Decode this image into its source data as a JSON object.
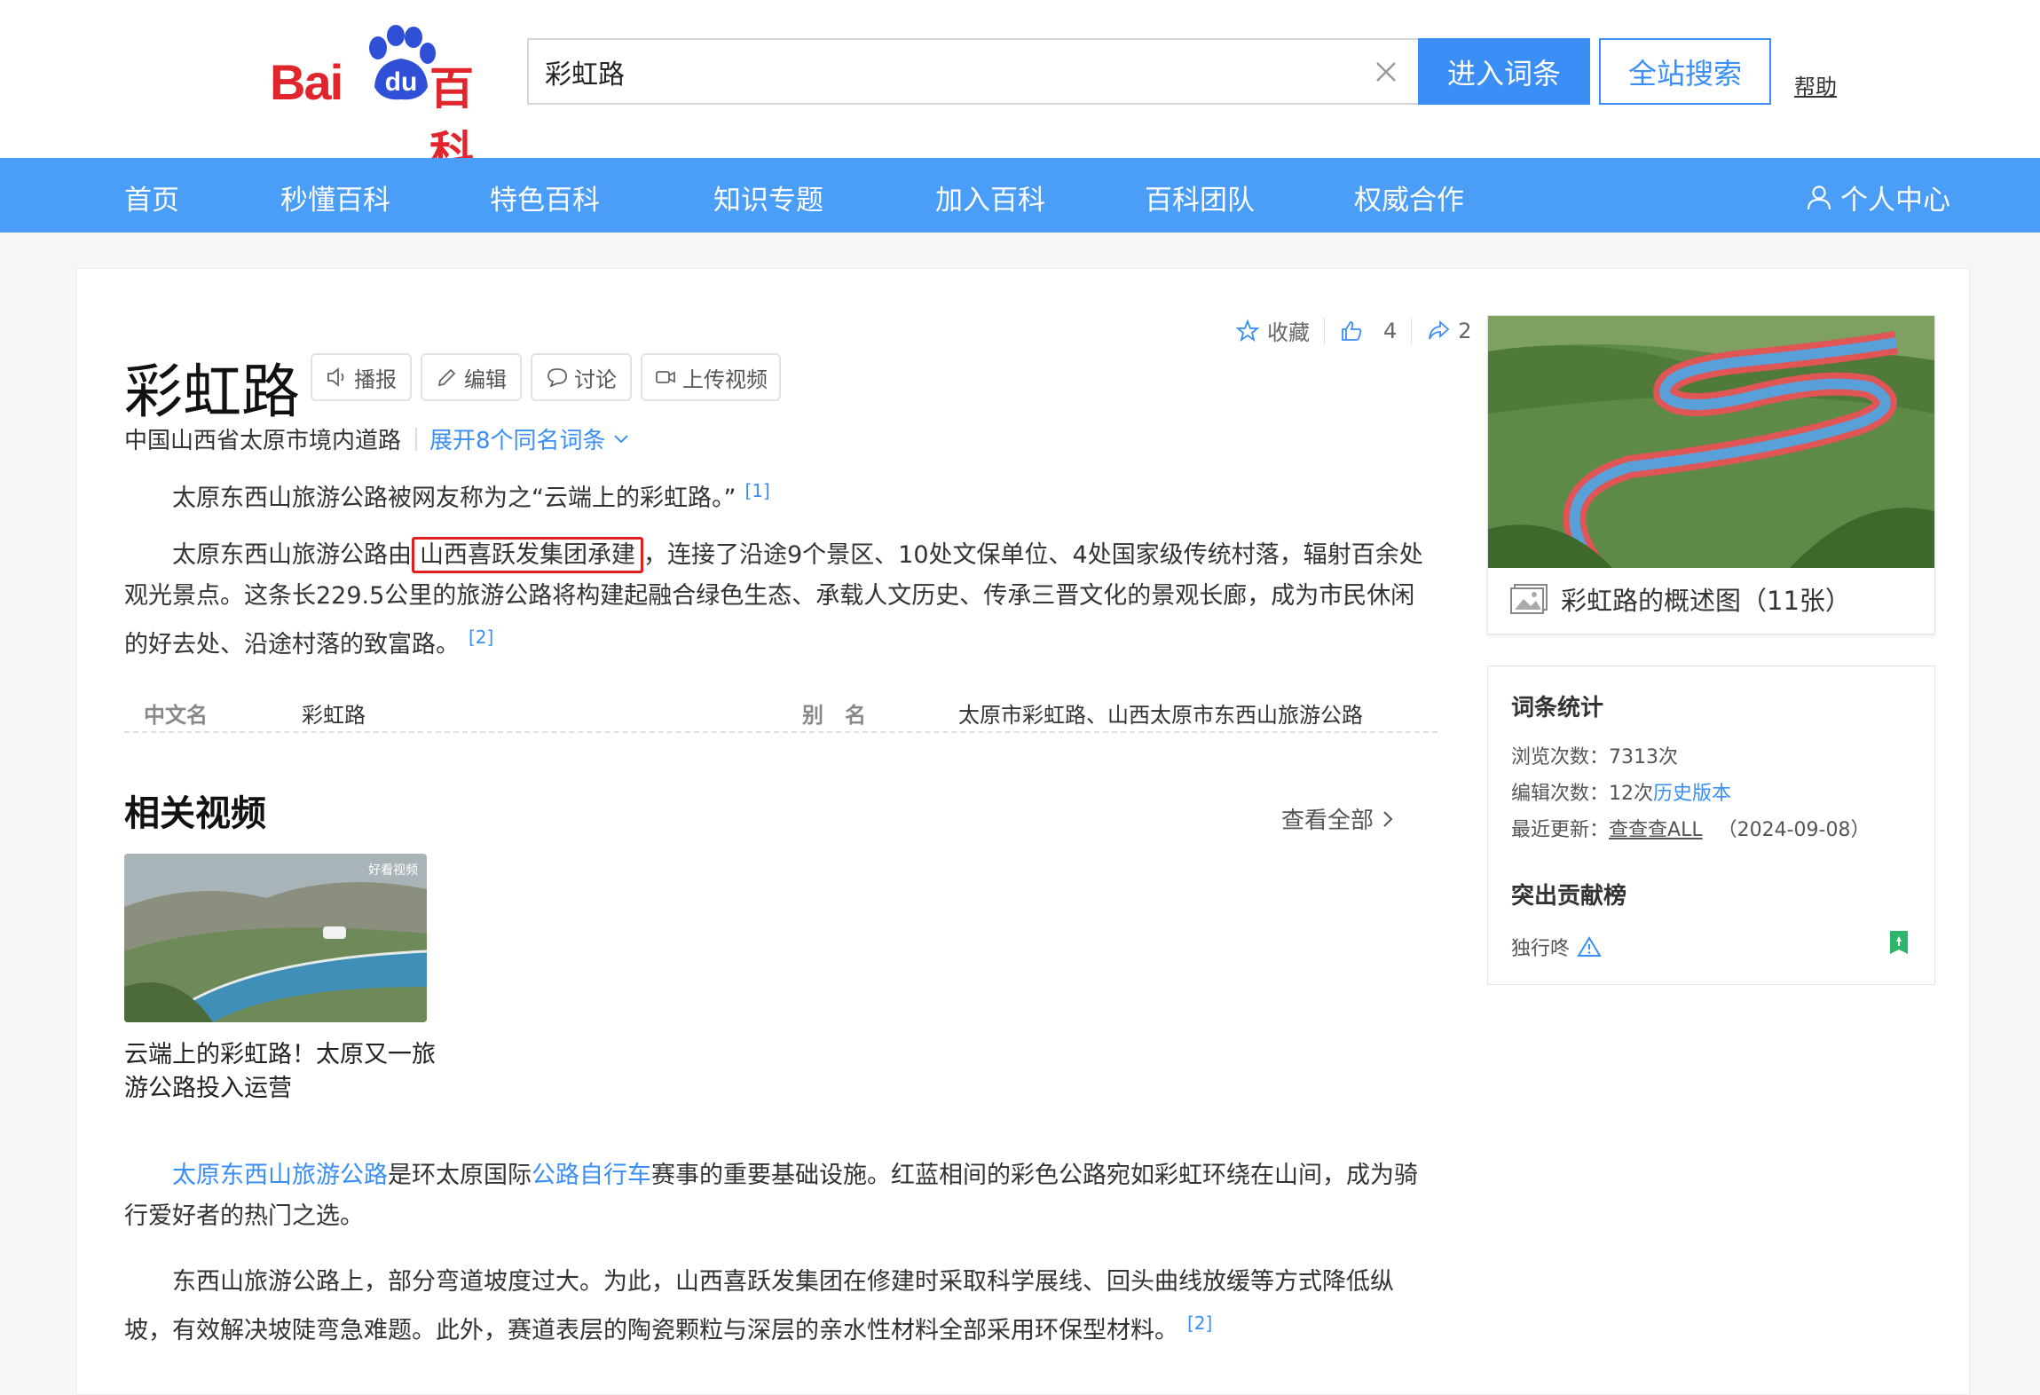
{
  "header": {
    "logo_text_bai": "Bai",
    "logo_text_du": "du",
    "logo_text_baike": "百科",
    "search_value": "彩虹路",
    "enter_button": "进入词条",
    "site_search_button": "全站搜索",
    "help": "帮助"
  },
  "nav": {
    "items": [
      "首页",
      "秒懂百科",
      "特色百科",
      "知识专题",
      "加入百科",
      "百科团队",
      "权威合作"
    ],
    "user_center": "个人中心"
  },
  "article": {
    "title": "彩虹路",
    "tools": [
      "播报",
      "编辑",
      "讨论",
      "上传视频"
    ],
    "actions": {
      "favorite": "收藏",
      "like_count": "4",
      "share_count": "2"
    },
    "subtitle": "中国山西省太原市境内道路",
    "expand_homonyms": "展开8个同名词条",
    "paragraph1": "太原东西山旅游公路被网友称为之“云端上的彩虹路。”",
    "paragraph1_ref": "[1]",
    "paragraph2_pre": "太原东西山旅游公路由",
    "paragraph2_highlight": "山西喜跃发集团承建",
    "paragraph2_post": "，连接了沿途9个景区、10处文保单位、4处国家级传统村落，辐射百余处观光景点。这条长229.5公里的旅游公路将构建起融合绿色生态、承载人文历史、传承三晋文化的景观长廊，成为市民休闲的好去处、沿途村落的致富路。",
    "paragraph2_ref": "[2]",
    "basic_info": {
      "label1": "中文名",
      "value1": "彩虹路",
      "label2": "别　名",
      "value2": "太原市彩虹路、山西太原市东西山旅游公路"
    },
    "related_videos_title": "相关视频",
    "view_all": "查看全部",
    "video": {
      "badge": "好看视频",
      "caption": "云端上的彩虹路！太原又一旅游公路投入运营"
    },
    "paragraph3_link1": "太原东西山旅游公路",
    "paragraph3_mid1": "是环太原国际",
    "paragraph3_link2": "公路自行车",
    "paragraph3_post": "赛事的重要基础设施。红蓝相间的彩色公路宛如彩虹环绕在山间，成为骑行爱好者的热门之选。",
    "paragraph4": "东西山旅游公路上，部分弯道坡度过大。为此，山西喜跃发集团在修建时采取科学展线、回头曲线放缓等方式降低纵坡，有效解决坡陡弯急难题。此外，赛道表层的陶瓷颗粒与深层的亲水性材料全部采用环保型材料。",
    "paragraph4_ref": "[2]"
  },
  "sidebar": {
    "album_caption": "彩虹路的概述图（11张）",
    "stats_title": "词条统计",
    "views_label": "浏览次数：",
    "views_value": "7313次",
    "edits_label": "编辑次数：",
    "edits_value": "12次",
    "history_link": "历史版本",
    "updated_label": "最近更新：",
    "updated_user": "查查查ALL",
    "updated_date": "（2024-09-08）",
    "contrib_title": "突出贡献榜",
    "contributor": "独行咚"
  },
  "colors": {
    "brand_red": "#e0262c",
    "accent_blue": "#3a8ef6",
    "nav_blue": "#4a9ef8",
    "highlight_red": "#e02020"
  }
}
